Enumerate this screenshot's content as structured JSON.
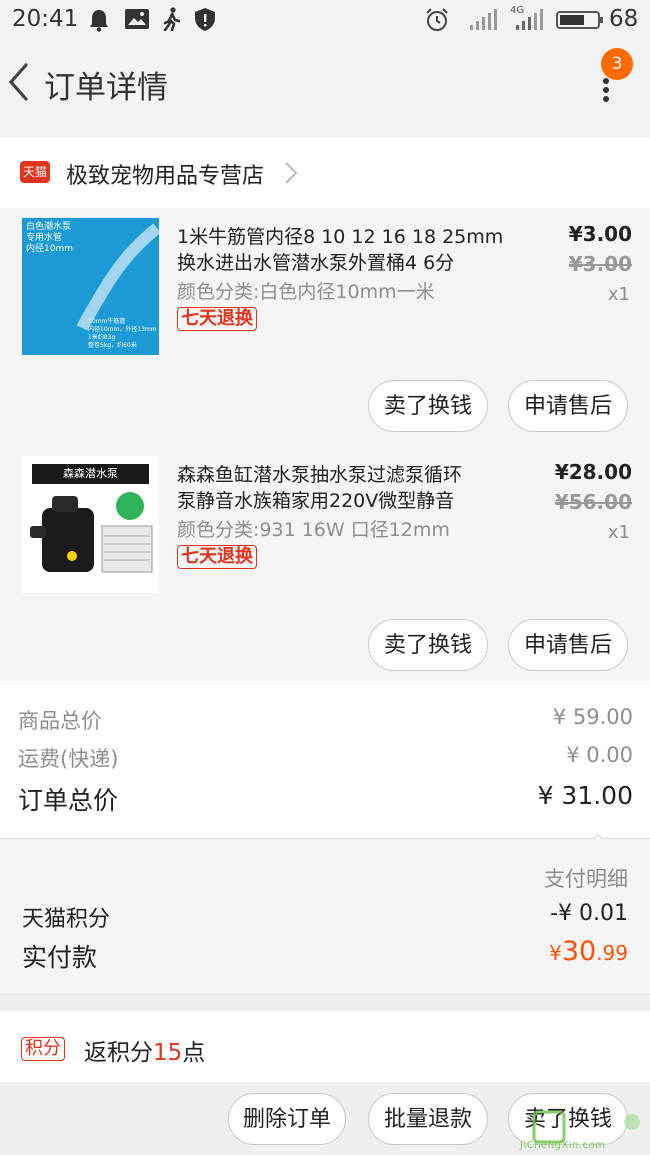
{
  "status_bar": {
    "time": "20:41",
    "network": "4G",
    "battery": "68",
    "icons": [
      "bell-icon",
      "image-icon",
      "walking-icon",
      "shield-icon",
      "alarm-icon",
      "signal-icon",
      "battery-icon"
    ]
  },
  "header": {
    "title": "订单详情",
    "badge_count": "3"
  },
  "store": {
    "badge": "天猫",
    "name": "极致宠物用品专营店"
  },
  "products": [
    {
      "thumb_lines": [
        "白色潮水泵",
        "专用水管",
        "内径10mm"
      ],
      "thumb_small": [
        "10mm牛筋管",
        "内径10mm，外径13mm",
        "1米约83g",
        "整卷5kg，约60米"
      ],
      "title_line1": "1米牛筋管内径8 10 12 16 18 25mm",
      "title_line2": "换水进出水管潜水泵外置桶4 6分",
      "sku": "颜色分类:白色内径10mm一米",
      "tag": "七天退换",
      "price": "¥3.00",
      "orig_price": "¥3.00",
      "qty": "x1",
      "btn1": "卖了换钱",
      "btn2": "申请售后"
    },
    {
      "thumb_title": "森森潜水泵",
      "title_line1": "森森鱼缸潜水泵抽水泵过滤泵循环",
      "title_line2": "泵静音水族箱家用220V微型静音",
      "sku": "颜色分类:931 16W 口径12mm",
      "tag": "七天退换",
      "price": "¥28.00",
      "orig_price": "¥56.00",
      "qty": "x1",
      "btn1": "卖了换钱",
      "btn2": "申请售后"
    }
  ],
  "summary": {
    "goods_label": "商品总价",
    "goods_value": "¥ 59.00",
    "shipping_label": "运费(快递)",
    "shipping_value": "¥ 0.00",
    "total_label": "订单总价",
    "total_value": "¥ 31.00"
  },
  "payment": {
    "detail_label": "支付明细",
    "points_label": "天猫积分",
    "points_value": "-¥ 0.01",
    "paid_label": "实付款",
    "paid_currency": "¥",
    "paid_int": "30",
    "paid_dec": ".99"
  },
  "rewards": {
    "tag": "积分",
    "text": "返积分",
    "points": "15",
    "unit": "点"
  },
  "footer": {
    "delete": "删除订单",
    "refund": "批量退款",
    "sell": "卖了换钱"
  },
  "watermark": "JiChengXin.com",
  "colors": {
    "accent": "#e2331c",
    "orange": "#ff5000",
    "badge": "#ff6a00"
  }
}
